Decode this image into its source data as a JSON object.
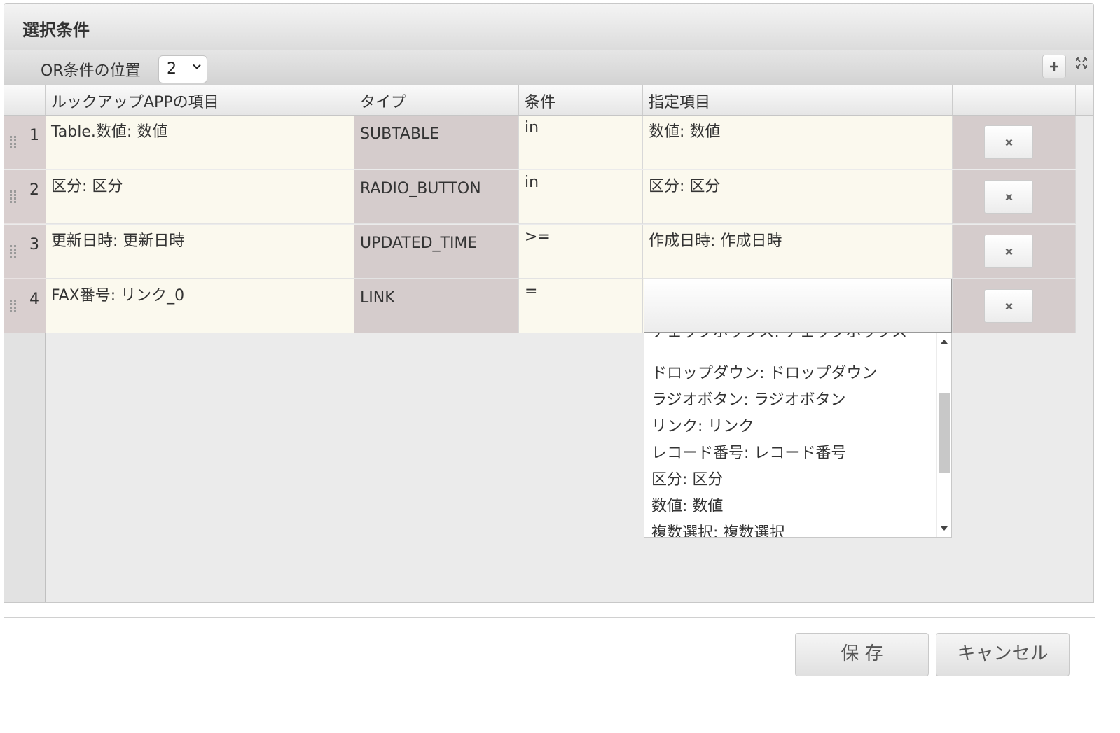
{
  "dialog": {
    "title": "選択条件"
  },
  "toolbar": {
    "or_position_label": "OR条件の位置",
    "or_position_value": "2",
    "add_label": "+"
  },
  "grid": {
    "headers": [
      "ルックアップAPPの項目",
      "タイプ",
      "条件",
      "指定項目",
      ""
    ],
    "rows": [
      {
        "num": "1",
        "field": "Table.数値: 数値",
        "type": "SUBTABLE",
        "condition": "in",
        "target": "数値: 数値"
      },
      {
        "num": "2",
        "field": "区分: 区分",
        "type": "RADIO_BUTTON",
        "condition": "in",
        "target": "区分: 区分"
      },
      {
        "num": "3",
        "field": "更新日時: 更新日時",
        "type": "UPDATED_TIME",
        "condition": ">=",
        "target": "作成日時: 作成日時"
      },
      {
        "num": "4",
        "field": "FAX番号: リンク_0",
        "type": "LINK",
        "condition": "=",
        "target": ""
      }
    ]
  },
  "dropdown": {
    "options": [
      "チェックボックス: チェックボックス",
      "ドロップダウン: ドロップダウン",
      "ラジオボタン: ラジオボタン",
      "リンク: リンク",
      "レコード番号: レコード番号",
      "区分: 区分",
      "数値: 数値",
      "複数選択: 複数選択"
    ]
  },
  "footer": {
    "save_label": "保 存",
    "cancel_label": "キャンセル"
  },
  "colors": {
    "row_light": "#fbf9ee",
    "row_dark": "#d5cccc",
    "panel_bg": "#ebebeb"
  }
}
